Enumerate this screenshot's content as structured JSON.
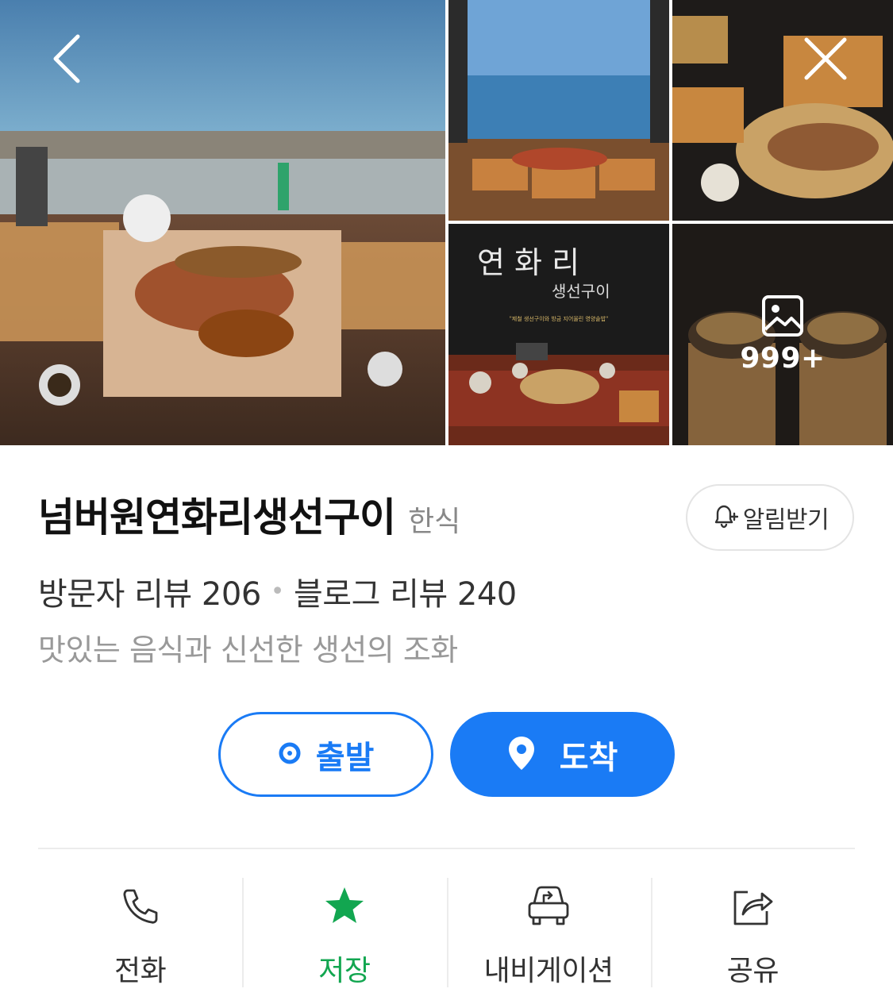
{
  "gallery": {
    "photos": [
      {
        "desc": "main-grilled-fish-table"
      },
      {
        "desc": "ocean-view-table"
      },
      {
        "desc": "fish-set-close-up"
      },
      {
        "desc": "brand-poster",
        "title_line1": "연 화 리",
        "title_line2": "생선구이",
        "tagline": "\"제철 생선구이와 방금 지어올린 영양솥밥\""
      },
      {
        "desc": "pot-rice"
      }
    ],
    "more_count": "999+"
  },
  "place": {
    "name": "넘버원연화리생선구이",
    "category": "한식",
    "notify_label": "알림받기",
    "visitor_reviews": "방문자 리뷰 206",
    "blog_reviews": "블로그 리뷰 240",
    "separator": "•",
    "description": "맛있는 음식과 신선한 생선의 조화"
  },
  "route": {
    "depart_label": "출발",
    "arrive_label": "도착"
  },
  "actions": [
    {
      "label": "전화",
      "icon": "phone-icon"
    },
    {
      "label": "저장",
      "icon": "star-icon",
      "active": true
    },
    {
      "label": "내비게이션",
      "icon": "car-navigation-icon"
    },
    {
      "label": "공유",
      "icon": "share-icon"
    }
  ],
  "colors": {
    "accent_blue": "#1a7bf5",
    "saved_green": "#12a650"
  }
}
